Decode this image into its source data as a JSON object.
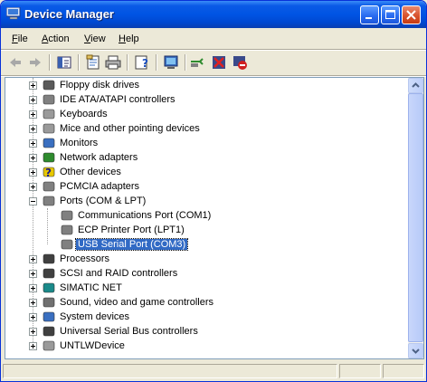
{
  "window": {
    "title": "Device Manager"
  },
  "menu": [
    {
      "pre": "",
      "u": "F",
      "post": "ile"
    },
    {
      "pre": "",
      "u": "A",
      "post": "ction"
    },
    {
      "pre": "",
      "u": "V",
      "post": "iew"
    },
    {
      "pre": "",
      "u": "H",
      "post": "elp"
    }
  ],
  "tree": {
    "items": [
      {
        "label": "Floppy disk drives",
        "icon": "floppy-drive-icon",
        "color": "#5a5a5a"
      },
      {
        "label": "IDE ATA/ATAPI controllers",
        "icon": "ide-controller-icon",
        "color": "#808080"
      },
      {
        "label": "Keyboards",
        "icon": "keyboard-icon",
        "color": "#9a9a9a"
      },
      {
        "label": "Mice and other pointing devices",
        "icon": "mouse-icon",
        "color": "#9a9a9a"
      },
      {
        "label": "Monitors",
        "icon": "monitor-icon",
        "color": "#3a6fc0"
      },
      {
        "label": "Network adapters",
        "icon": "network-adapter-icon",
        "color": "#2e8b2e"
      },
      {
        "label": "Other devices",
        "icon": "question-mark-icon",
        "color": "#e8c800"
      },
      {
        "label": "PCMCIA adapters",
        "icon": "pcmcia-icon",
        "color": "#808080"
      },
      {
        "label": "Ports (COM & LPT)",
        "icon": "port-connector-icon",
        "color": "#808080",
        "expanded": true,
        "children": [
          {
            "label": "Communications Port (COM1)",
            "icon": "port-connector-icon",
            "color": "#808080"
          },
          {
            "label": "ECP Printer Port (LPT1)",
            "icon": "port-connector-icon",
            "color": "#808080"
          },
          {
            "label": "USB Serial Port (COM3)",
            "icon": "port-connector-icon",
            "color": "#808080",
            "selected": true
          }
        ]
      },
      {
        "label": "Processors",
        "icon": "processor-icon",
        "color": "#404040"
      },
      {
        "label": "SCSI and RAID controllers",
        "icon": "scsi-controller-icon",
        "color": "#404040"
      },
      {
        "label": "SIMATIC NET",
        "icon": "simatic-net-icon",
        "color": "#1a8a8a"
      },
      {
        "label": "Sound, video and game controllers",
        "icon": "sound-icon",
        "color": "#707070"
      },
      {
        "label": "System devices",
        "icon": "system-devices-icon",
        "color": "#3a6fc0"
      },
      {
        "label": "Universal Serial Bus controllers",
        "icon": "usb-icon",
        "color": "#404040"
      },
      {
        "label": "UNTLWDevice",
        "icon": "generic-device-icon",
        "color": "#9a9a9a"
      }
    ]
  }
}
